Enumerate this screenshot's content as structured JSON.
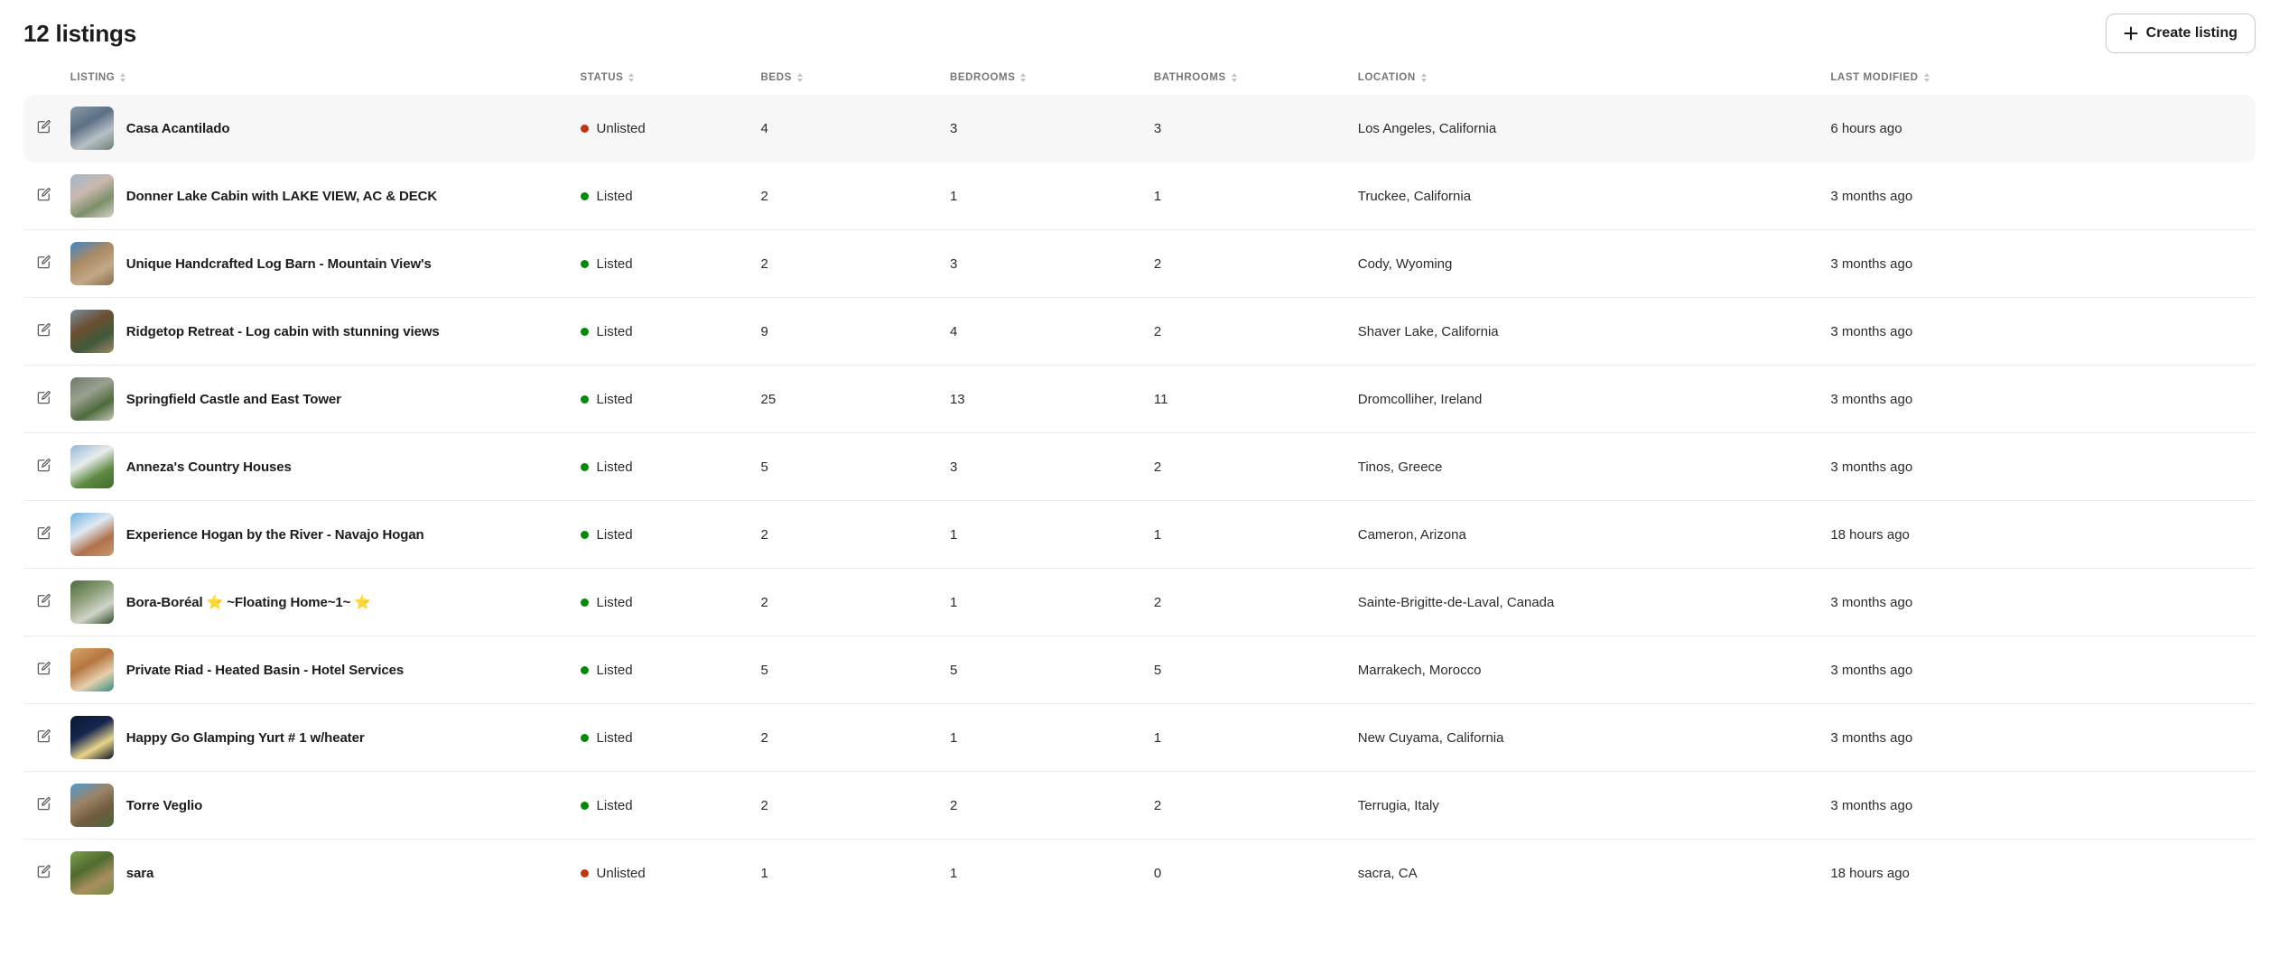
{
  "header": {
    "title": "12 listings",
    "create_button": {
      "label": "Create listing",
      "icon": "plus-icon"
    }
  },
  "table": {
    "columns": [
      {
        "key": "listing",
        "label": "LISTING",
        "sortable": true
      },
      {
        "key": "status",
        "label": "STATUS",
        "sortable": true
      },
      {
        "key": "beds",
        "label": "BEDS",
        "sortable": true
      },
      {
        "key": "bedrooms",
        "label": "BEDROOMS",
        "sortable": true
      },
      {
        "key": "bathrooms",
        "label": "BATHROOMS",
        "sortable": true
      },
      {
        "key": "location",
        "label": "LOCATION",
        "sortable": true
      },
      {
        "key": "modified",
        "label": "LAST MODIFIED",
        "sortable": true
      }
    ],
    "status_colors": {
      "listed": "#008A05",
      "unlisted": "#C13515"
    },
    "rows": [
      {
        "name": "Casa Acantilado",
        "status": "Unlisted",
        "status_kind": "unlisted",
        "beds": "4",
        "bedrooms": "3",
        "bathrooms": "3",
        "location": "Los Angeles, California",
        "modified": "6 hours ago",
        "selected": true,
        "thumb": "aerial-white-modern-house",
        "thumb_colors": [
          "#8d9aa6",
          "#5c6f85",
          "#b7c0c6",
          "#6e7f72"
        ]
      },
      {
        "name": "Donner Lake Cabin with LAKE VIEW, AC & DECK",
        "status": "Listed",
        "status_kind": "listed",
        "beds": "2",
        "bedrooms": "1",
        "bathrooms": "1",
        "location": "Truckee, California",
        "modified": "3 months ago",
        "selected": false,
        "thumb": "snowy-cabin-pink-roof",
        "thumb_colors": [
          "#9fb6cf",
          "#cbb8ae",
          "#7b8f6a",
          "#d8d2cb"
        ]
      },
      {
        "name": "Unique Handcrafted Log Barn - Mountain View's",
        "status": "Listed",
        "status_kind": "listed",
        "beds": "2",
        "bedrooms": "3",
        "bathrooms": "2",
        "location": "Cody, Wyoming",
        "modified": "3 months ago",
        "selected": false,
        "thumb": "log-barn-desert-mountain",
        "thumb_colors": [
          "#3f86c9",
          "#a98a63",
          "#c2a887",
          "#8a6f4e"
        ]
      },
      {
        "name": "Ridgetop Retreat - Log cabin with stunning views",
        "status": "Listed",
        "status_kind": "listed",
        "beds": "9",
        "bedrooms": "4",
        "bathrooms": "2",
        "location": "Shaver Lake, California",
        "modified": "3 months ago",
        "selected": false,
        "thumb": "log-cabin-pine-forest",
        "thumb_colors": [
          "#7a8f9c",
          "#6b4f33",
          "#3f5a3a",
          "#a08a6a"
        ]
      },
      {
        "name": "Springfield Castle and East Tower",
        "status": "Listed",
        "status_kind": "listed",
        "beds": "25",
        "bedrooms": "13",
        "bathrooms": "11",
        "location": "Dromcolliher, Ireland",
        "modified": "3 months ago",
        "selected": false,
        "thumb": "stone-castle-green-lawn",
        "thumb_colors": [
          "#6f7a6a",
          "#9aa08f",
          "#4e6b3c",
          "#c3c7bb"
        ]
      },
      {
        "name": "Anneza's Country Houses",
        "status": "Listed",
        "status_kind": "listed",
        "beds": "5",
        "bedrooms": "3",
        "bathrooms": "2",
        "location": "Tinos, Greece",
        "modified": "3 months ago",
        "selected": false,
        "thumb": "white-house-green-field",
        "thumb_colors": [
          "#8fb8d8",
          "#e9ecec",
          "#5d8a41",
          "#3f6b2d"
        ]
      },
      {
        "name": "Experience Hogan by the River - Navajo Hogan",
        "status": "Listed",
        "status_kind": "listed",
        "beds": "2",
        "bedrooms": "1",
        "bathrooms": "1",
        "location": "Cameron, Arizona",
        "modified": "18 hours ago",
        "selected": false,
        "thumb": "desert-hogan-blue-sky",
        "thumb_colors": [
          "#6fb2e0",
          "#dfe9f2",
          "#b0714a",
          "#c79a6e"
        ]
      },
      {
        "name": "Bora-Boréal ⭐ ~Floating Home~1~ ⭐",
        "status": "Listed",
        "status_kind": "listed",
        "beds": "2",
        "bedrooms": "1",
        "bathrooms": "2",
        "location": "Sainte-Brigitte-de-Laval, Canada",
        "modified": "3 months ago",
        "selected": false,
        "thumb": "floating-home-forest",
        "thumb_colors": [
          "#4c6b3a",
          "#8fa07c",
          "#cfd4c8",
          "#2f4a26"
        ]
      },
      {
        "name": "Private Riad - Heated Basin - Hotel Services",
        "status": "Listed",
        "status_kind": "listed",
        "beds": "5",
        "bedrooms": "5",
        "bathrooms": "5",
        "location": "Marrakech, Morocco",
        "modified": "3 months ago",
        "selected": false,
        "thumb": "riad-courtyard-orange",
        "thumb_colors": [
          "#d8a86a",
          "#b4763f",
          "#e6cfae",
          "#2f8f7f"
        ]
      },
      {
        "name": "Happy Go Glamping Yurt # 1 w/heater",
        "status": "Listed",
        "status_kind": "listed",
        "beds": "2",
        "bedrooms": "1",
        "bathrooms": "1",
        "location": "New Cuyama, California",
        "modified": "3 months ago",
        "selected": false,
        "thumb": "night-yurt-starry-sky",
        "thumb_colors": [
          "#0b1733",
          "#16264f",
          "#e8d48a",
          "#0a1020"
        ]
      },
      {
        "name": "Torre Veglio",
        "status": "Listed",
        "status_kind": "listed",
        "beds": "2",
        "bedrooms": "2",
        "bathrooms": "2",
        "location": "Terrugia, Italy",
        "modified": "3 months ago",
        "selected": false,
        "thumb": "stone-tower-blue-sky",
        "thumb_colors": [
          "#4e9bd4",
          "#9b8366",
          "#6f5a3e",
          "#4a6b3a"
        ]
      },
      {
        "name": "sara",
        "status": "Unlisted",
        "status_kind": "unlisted",
        "beds": "1",
        "bedrooms": "1",
        "bathrooms": "0",
        "location": "sacra, CA",
        "modified": "18 hours ago",
        "selected": false,
        "thumb": "green-field-horses",
        "thumb_colors": [
          "#7fa04f",
          "#4f6b2f",
          "#a98f5e",
          "#6f8a42"
        ]
      }
    ]
  }
}
